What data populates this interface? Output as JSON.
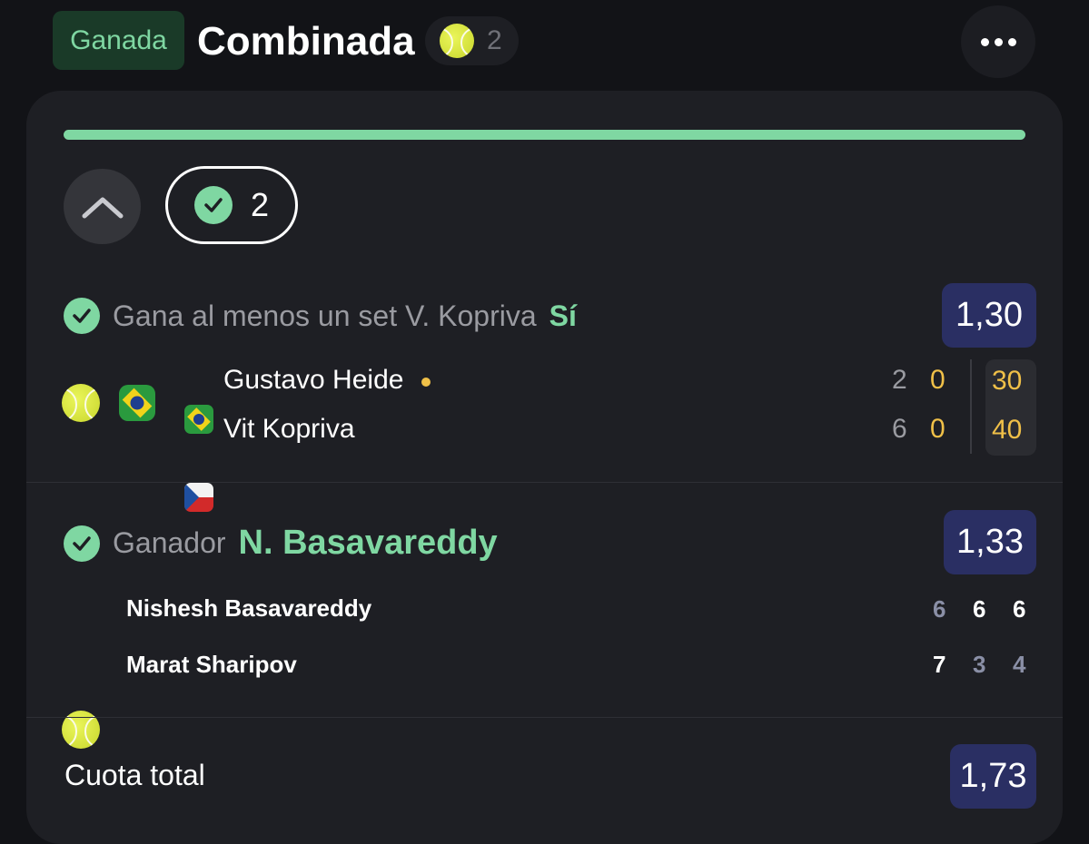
{
  "header": {
    "status": "Ganada",
    "title": "Combinada",
    "sport_count": "2",
    "sport_icon": "tennis-ball-icon",
    "more_icon": "more-dots-icon"
  },
  "progress": {
    "value": 1.0,
    "color": "#7fd7a2"
  },
  "summary": {
    "checked_count": "2"
  },
  "selections": [
    {
      "label": "Gana al menos un set V. Kopriva",
      "value": "Sí",
      "odds": "1,30",
      "match": {
        "players": [
          {
            "name": "Gustavo Heide",
            "flag": "brazil-flag-icon",
            "serving": true,
            "sets": [
              "2",
              "0"
            ],
            "points": "30"
          },
          {
            "name": "Vit Kopriva",
            "flag": "czech-flag-icon",
            "serving": false,
            "sets": [
              "6",
              "0"
            ],
            "points": "40"
          }
        ]
      }
    },
    {
      "label": "Ganador",
      "value": "N. Basavareddy",
      "odds": "1,33",
      "match": {
        "players": [
          {
            "name": "Nishesh Basavareddy",
            "sets": [
              "6",
              "6",
              "6"
            ]
          },
          {
            "name": "Marat Sharipov",
            "sets": [
              "7",
              "3",
              "4"
            ]
          }
        ]
      }
    }
  ],
  "total": {
    "label": "Cuota total",
    "odds": "1,73"
  },
  "colors": {
    "accent": "#7fd7a2",
    "odds_bg": "#2a2f63",
    "live_score": "#f0c048",
    "card_bg": "#1e1f24"
  }
}
